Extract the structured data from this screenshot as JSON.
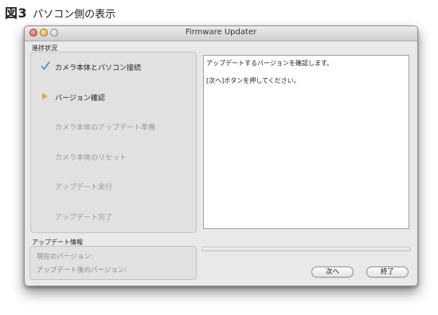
{
  "figure": {
    "number": "図3",
    "caption": "パソコン側の表示"
  },
  "window": {
    "title": "Firmware Updater"
  },
  "progress_section": {
    "heading": "進捗状況",
    "steps": [
      {
        "label": "カメラ本体とパソコン接続",
        "state": "done"
      },
      {
        "label": "バージョン確認",
        "state": "current"
      },
      {
        "label": "カメラ本体のアップデート準備",
        "state": "pending"
      },
      {
        "label": "カメラ本体のリセット",
        "state": "pending"
      },
      {
        "label": "アップデート実行",
        "state": "pending"
      },
      {
        "label": "アップデート完了",
        "state": "pending"
      }
    ]
  },
  "message": {
    "line1": "アップデートするバージョンを確認します。",
    "line2": "[次へ]ボタンを押してください。"
  },
  "update_info": {
    "heading": "アップデート情報",
    "current_version_label": "現在のバージョン:",
    "after_version_label": "アップデート後のバージョン:"
  },
  "progress_bar": {
    "value": 0
  },
  "buttons": {
    "next": "次へ",
    "quit": "終了"
  },
  "colors": {
    "check": "#4a86c5",
    "current_arrow": "#e8a23c",
    "pending_text": "#9a9a9a"
  }
}
